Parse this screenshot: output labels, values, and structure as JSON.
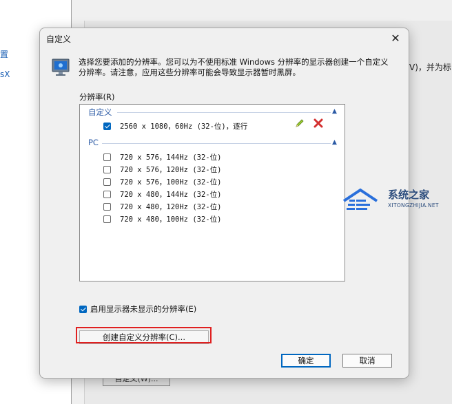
{
  "background": {
    "left_items": [
      "置",
      "sX"
    ],
    "right_text": "V)，并为标",
    "partial_button": "自定义(W)..."
  },
  "dialog": {
    "title": "自定义",
    "description": "选择您要添加的分辨率。您可以为不使用标准 Windows 分辨率的显示器创建一个自定义分辨率。请注意，应用这些分辨率可能会导致显示器暂时黑屏。",
    "list_label": "分辨率(R)",
    "groups": [
      {
        "name": "自定义",
        "items": [
          {
            "label": "2560 x 1080，60Hz (32-位)，逐行",
            "checked": true
          }
        ]
      },
      {
        "name": "PC",
        "items": [
          {
            "label": "720 x 576，144Hz (32-位)",
            "checked": false
          },
          {
            "label": "720 x 576，120Hz (32-位)",
            "checked": false
          },
          {
            "label": "720 x 576，100Hz (32-位)",
            "checked": false
          },
          {
            "label": "720 x 480，144Hz (32-位)",
            "checked": false
          },
          {
            "label": "720 x 480，120Hz (32-位)",
            "checked": false
          },
          {
            "label": "720 x 480，100Hz (32-位)",
            "checked": false
          }
        ]
      }
    ],
    "enable_label": "启用显示器未显示的分辨率(E)",
    "enable_checked": true,
    "create_button": "创建自定义分辨率(C)...",
    "ok_button": "确定",
    "cancel_button": "取消"
  },
  "watermark": {
    "title": "系统之家",
    "subtitle": "XITONGZHIJIA.NET"
  },
  "colors": {
    "accent": "#0067c0",
    "group_header": "#2b5aa5",
    "highlight_border": "#e02020",
    "delete_icon": "#d32f2f"
  }
}
